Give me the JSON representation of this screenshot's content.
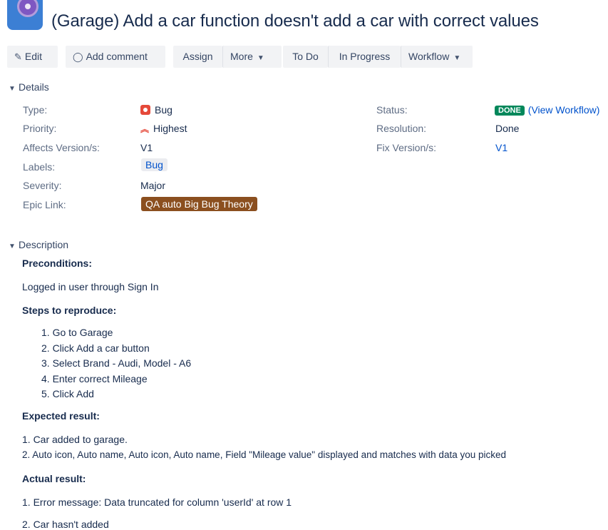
{
  "issue": {
    "title": "(Garage) Add a car function doesn't add a car with correct values"
  },
  "toolbar": {
    "edit": "Edit",
    "add_comment": "Add comment",
    "assign": "Assign",
    "more": "More",
    "todo": "To Do",
    "in_progress": "In Progress",
    "workflow": "Workflow"
  },
  "details": {
    "heading": "Details",
    "type_label": "Type:",
    "type_value": "Bug",
    "priority_label": "Priority:",
    "priority_value": "Highest",
    "affects_label": "Affects Version/s:",
    "affects_value": "V1",
    "labels_label": "Labels:",
    "labels_value": "Bug",
    "severity_label": "Severity:",
    "severity_value": "Major",
    "epic_label": "Epic Link:",
    "epic_value": "QA auto Big Bug Theory",
    "status_label": "Status:",
    "status_value": "DONE",
    "view_workflow": "(View Workflow)",
    "resolution_label": "Resolution:",
    "resolution_value": "Done",
    "fix_label": "Fix Version/s:",
    "fix_value": "V1"
  },
  "description": {
    "heading": "Description",
    "preconditions_heading": "Preconditions:",
    "preconditions_text": "Logged in user through Sign In",
    "steps_heading": "Steps to reproduce:",
    "steps": [
      "1. Go to Garage",
      "2. Click Add a car button",
      "3. Select Brand - Audi, Model - A6",
      "4. Enter correct Mileage",
      "5. Click Add"
    ],
    "expected_heading": "Expected result:",
    "expected": [
      "1. Car added to garage.",
      "2. Auto icon, Auto name, Auto icon, Auto name, Field \"Mileage value\" displayed and matches with data you picked"
    ],
    "actual_heading": "Actual result:",
    "actual": [
      "1. Error message: Data truncated for column 'userId' at row 1",
      "2. Car hasn't added"
    ]
  },
  "colors": {
    "status_done": "#00875a",
    "epic": "#8b4f1f",
    "link": "#0052cc",
    "bug": "#e5493a"
  },
  "icons": {
    "edit": "pencil-icon",
    "comment": "comment-icon",
    "type": "bug-icon",
    "priority": "priority-highest-icon"
  }
}
